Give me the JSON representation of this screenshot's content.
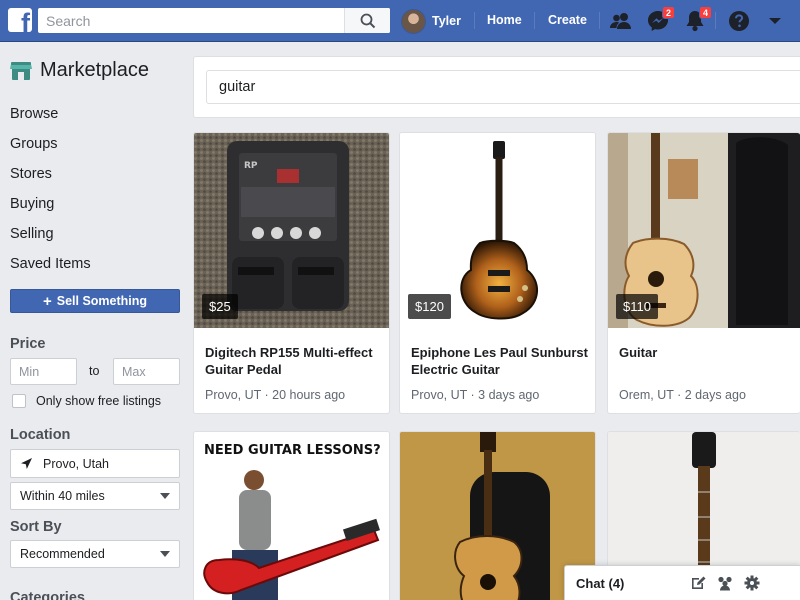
{
  "topbar": {
    "search_placeholder": "Search",
    "profile_name": "Tyler",
    "home_label": "Home",
    "create_label": "Create",
    "messenger_badge": "2",
    "notifications_badge": "4"
  },
  "sidebar": {
    "title": "Marketplace",
    "items": [
      {
        "label": "Browse"
      },
      {
        "label": "Groups"
      },
      {
        "label": "Stores"
      },
      {
        "label": "Buying"
      },
      {
        "label": "Selling"
      },
      {
        "label": "Saved Items"
      }
    ],
    "sell_label": "Sell Something",
    "price": {
      "title": "Price",
      "min_placeholder": "Min",
      "to_label": "to",
      "max_placeholder": "Max",
      "free_label": "Only show free listings"
    },
    "location": {
      "title": "Location",
      "value": "Provo, Utah",
      "radius": "Within 40 miles"
    },
    "sort": {
      "title": "Sort By",
      "value": "Recommended"
    },
    "categories_title": "Categories"
  },
  "main": {
    "search_value": "guitar",
    "listings": [
      {
        "price": "$25",
        "title": "Digitech RP155 Multi-effect Guitar Pedal",
        "meta": "Provo, UT · 20 hours ago"
      },
      {
        "price": "$120",
        "title": "Epiphone Les Paul Sunburst Electric Guitar",
        "meta": "Provo, UT · 3 days ago"
      },
      {
        "price": "$110",
        "title": "Guitar",
        "meta": "Orem, UT · 2 days ago"
      },
      {
        "banner": "NEED GUITAR LESSONS?"
      },
      {},
      {}
    ]
  },
  "chat": {
    "label": "Chat (4)"
  },
  "colors": {
    "brand_blue": "#4267b2",
    "badge_red": "#fa3e3e",
    "page_bg": "#e9ebee"
  }
}
